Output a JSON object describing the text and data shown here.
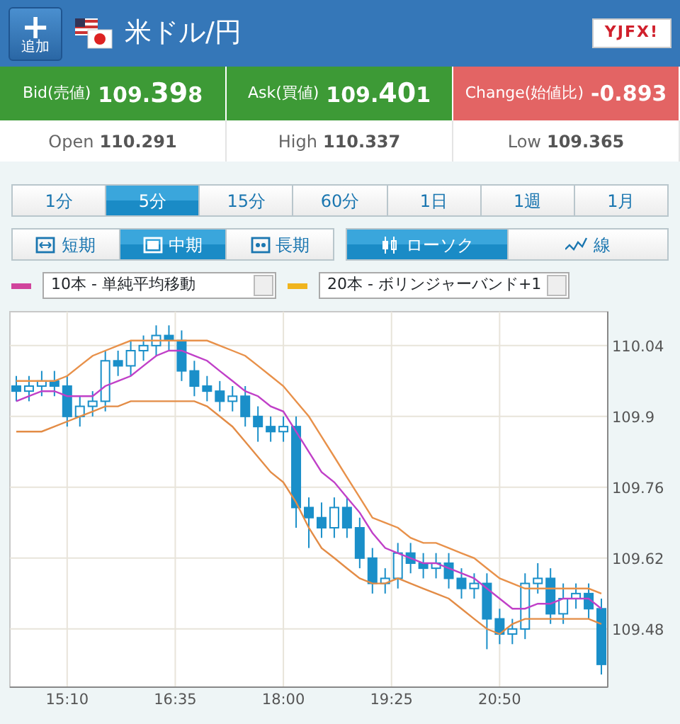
{
  "header": {
    "add_button": {
      "label": "追加",
      "icon": "+"
    },
    "title": "米ドル/円",
    "logo": "YJFX!"
  },
  "quotes": [
    {
      "kind": "up",
      "label": "Bid(売値)",
      "head": "109.",
      "big": "39",
      "tail": "8"
    },
    {
      "kind": "up",
      "label": "Ask(買値)",
      "head": "109.",
      "big": "40",
      "tail": "1"
    },
    {
      "kind": "down",
      "label": "Change(始値比)",
      "head": "-0.893"
    }
  ],
  "stats": [
    {
      "label": "Open",
      "value": "110.291"
    },
    {
      "label": "High",
      "value": "110.337"
    },
    {
      "label": "Low",
      "value": "109.365"
    }
  ],
  "periods": [
    {
      "label": "1分",
      "selected": false
    },
    {
      "label": "5分",
      "selected": true
    },
    {
      "label": "15分",
      "selected": false
    },
    {
      "label": "60分",
      "selected": false
    },
    {
      "label": "1日",
      "selected": false
    },
    {
      "label": "1週",
      "selected": false
    },
    {
      "label": "1月",
      "selected": false
    }
  ],
  "ranges": [
    {
      "kind": "short",
      "label": "短期",
      "selected": false
    },
    {
      "kind": "mid",
      "label": "中期",
      "selected": true
    },
    {
      "kind": "long",
      "label": "長期",
      "selected": false
    }
  ],
  "chart_types": [
    {
      "kind": "candle",
      "label": "ローソク",
      "selected": true
    },
    {
      "kind": "line",
      "label": "線",
      "selected": false
    }
  ],
  "indicators": [
    {
      "color": "#d0449c",
      "value": "10本 - 単純平均移動"
    },
    {
      "color": "#f0b41e",
      "value": "20本 - ボリンジャーバンド+1"
    }
  ],
  "chart_data": {
    "type": "candlestick",
    "grid": true,
    "x": [
      14.5,
      14.6667,
      14.8333,
      15,
      15.1667,
      15.3333,
      15.5,
      15.6667,
      15.8333,
      16,
      16.1667,
      16.3333,
      16.5,
      16.6667,
      16.8333,
      17,
      17.1667,
      17.3333,
      17.5,
      17.6667,
      17.8333,
      18,
      18.1667,
      18.3333,
      18.5,
      18.6667,
      18.8333,
      19,
      19.1667,
      19.3333,
      19.5,
      19.6667,
      19.8333,
      20,
      20.1667,
      20.3333,
      20.5,
      20.6667,
      20.8333,
      21,
      21.1667,
      21.3333,
      21.5,
      21.6667,
      21.8333,
      22,
      22.1667
    ],
    "xlim": [
      14.4167,
      22.25
    ],
    "ylim": [
      109.365,
      110.107
    ],
    "xticks": [
      {
        "value": 15.1667,
        "label": "15:10"
      },
      {
        "value": 16.5833,
        "label": "16:35"
      },
      {
        "value": 18,
        "label": "18:00"
      },
      {
        "value": 19.4167,
        "label": "19:25"
      },
      {
        "value": 20.8333,
        "label": "20:50"
      }
    ],
    "yticks": [
      109.48,
      109.62,
      109.76,
      {
        "value": 109.9,
        "label": "109.9"
      },
      110.04
    ],
    "color": "#1a8fc9",
    "ohlc": [
      [
        109.96,
        109.98,
        109.93,
        109.95
      ],
      [
        109.95,
        109.98,
        109.93,
        109.96
      ],
      [
        109.96,
        109.99,
        109.94,
        109.97
      ],
      [
        109.97,
        109.99,
        109.94,
        109.96
      ],
      [
        109.96,
        109.98,
        109.88,
        109.9
      ],
      [
        109.9,
        109.94,
        109.88,
        109.92
      ],
      [
        109.92,
        109.95,
        109.9,
        109.93
      ],
      [
        109.93,
        110.03,
        109.91,
        110.01
      ],
      [
        110.01,
        110.03,
        109.98,
        110.0
      ],
      [
        110.0,
        110.05,
        109.98,
        110.03
      ],
      [
        110.03,
        110.06,
        110.01,
        110.04
      ],
      [
        110.04,
        110.08,
        110.02,
        110.06
      ],
      [
        110.06,
        110.08,
        110.03,
        110.05
      ],
      [
        110.05,
        110.07,
        109.97,
        109.99
      ],
      [
        109.99,
        110.01,
        109.94,
        109.96
      ],
      [
        109.96,
        109.98,
        109.93,
        109.95
      ],
      [
        109.95,
        109.97,
        109.91,
        109.93
      ],
      [
        109.93,
        109.96,
        109.91,
        109.94
      ],
      [
        109.94,
        109.96,
        109.88,
        109.9
      ],
      [
        109.9,
        109.92,
        109.85,
        109.88
      ],
      [
        109.88,
        109.9,
        109.85,
        109.87
      ],
      [
        109.87,
        109.9,
        109.85,
        109.88
      ],
      [
        109.88,
        109.9,
        109.68,
        109.72
      ],
      [
        109.72,
        109.74,
        109.64,
        109.7
      ],
      [
        109.7,
        109.73,
        109.66,
        109.68
      ],
      [
        109.68,
        109.74,
        109.66,
        109.72
      ],
      [
        109.72,
        109.74,
        109.66,
        109.68
      ],
      [
        109.68,
        109.7,
        109.6,
        109.62
      ],
      [
        109.62,
        109.64,
        109.55,
        109.57
      ],
      [
        109.57,
        109.6,
        109.55,
        109.58
      ],
      [
        109.58,
        109.65,
        109.56,
        109.63
      ],
      [
        109.63,
        109.65,
        109.59,
        109.61
      ],
      [
        109.61,
        109.63,
        109.58,
        109.6
      ],
      [
        109.6,
        109.63,
        109.58,
        109.61
      ],
      [
        109.61,
        109.63,
        109.56,
        109.58
      ],
      [
        109.58,
        109.6,
        109.54,
        109.56
      ],
      [
        109.56,
        109.59,
        109.54,
        109.57
      ],
      [
        109.57,
        109.59,
        109.44,
        109.5
      ],
      [
        109.5,
        109.52,
        109.45,
        109.47
      ],
      [
        109.47,
        109.5,
        109.45,
        109.48
      ],
      [
        109.48,
        109.59,
        109.46,
        109.57
      ],
      [
        109.57,
        109.61,
        109.55,
        109.58
      ],
      [
        109.58,
        109.6,
        109.49,
        109.51
      ],
      [
        109.51,
        109.57,
        109.49,
        109.54
      ],
      [
        109.54,
        109.57,
        109.52,
        109.55
      ],
      [
        109.55,
        109.57,
        109.5,
        109.52
      ],
      [
        109.52,
        109.54,
        109.39,
        109.41
      ]
    ],
    "series": [
      {
        "type": "line",
        "color": "#c040c8",
        "x": [
          14.5,
          14.6667,
          14.8333,
          15,
          15.1667,
          15.3333,
          15.5,
          15.6667,
          15.8333,
          16,
          16.1667,
          16.3333,
          16.5,
          16.6667,
          16.8333,
          17,
          17.1667,
          17.3333,
          17.5,
          17.6667,
          17.8333,
          18,
          18.1667,
          18.3333,
          18.5,
          18.6667,
          18.8333,
          19,
          19.1667,
          19.3333,
          19.5,
          19.6667,
          19.8333,
          20,
          20.1667,
          20.3333,
          20.5,
          20.6667,
          20.8333,
          21,
          21.1667,
          21.3333,
          21.5,
          21.6667,
          21.8333,
          22,
          22.1667
        ],
        "values": [
          109.93,
          109.94,
          109.95,
          109.95,
          109.94,
          109.94,
          109.94,
          109.96,
          109.97,
          109.98,
          110.0,
          110.02,
          110.03,
          110.03,
          110.02,
          110.01,
          109.99,
          109.97,
          109.95,
          109.94,
          109.92,
          109.91,
          109.87,
          109.83,
          109.79,
          109.77,
          109.74,
          109.71,
          109.67,
          109.64,
          109.63,
          109.62,
          109.61,
          109.61,
          109.6,
          109.59,
          109.58,
          109.56,
          109.54,
          109.52,
          109.52,
          109.53,
          109.53,
          109.54,
          109.54,
          109.54,
          109.52
        ]
      },
      {
        "type": "line",
        "color": "#e8914a",
        "x": [
          14.5,
          14.6667,
          14.8333,
          15,
          15.1667,
          15.3333,
          15.5,
          15.6667,
          15.8333,
          16,
          16.1667,
          16.3333,
          16.5,
          16.6667,
          16.8333,
          17,
          17.1667,
          17.3333,
          17.5,
          17.6667,
          17.8333,
          18,
          18.1667,
          18.3333,
          18.5,
          18.6667,
          18.8333,
          19,
          19.1667,
          19.3333,
          19.5,
          19.6667,
          19.8333,
          20,
          20.1667,
          20.3333,
          20.5,
          20.6667,
          20.8333,
          21,
          21.1667,
          21.3333,
          21.5,
          21.6667,
          21.8333,
          22,
          22.1667
        ],
        "values": [
          109.97,
          109.97,
          109.97,
          109.97,
          109.98,
          110.0,
          110.02,
          110.03,
          110.04,
          110.05,
          110.05,
          110.05,
          110.05,
          110.05,
          110.05,
          110.05,
          110.04,
          110.03,
          110.02,
          110.0,
          109.98,
          109.96,
          109.93,
          109.9,
          109.86,
          109.82,
          109.78,
          109.74,
          109.7,
          109.69,
          109.68,
          109.66,
          109.65,
          109.65,
          109.64,
          109.63,
          109.62,
          109.6,
          109.58,
          109.57,
          109.56,
          109.56,
          109.56,
          109.56,
          109.56,
          109.56,
          109.55
        ]
      },
      {
        "type": "line",
        "color": "#e38c46",
        "x": [
          14.5,
          14.6667,
          14.8333,
          15,
          15.1667,
          15.3333,
          15.5,
          15.6667,
          15.8333,
          16,
          16.1667,
          16.3333,
          16.5,
          16.6667,
          16.8333,
          17,
          17.1667,
          17.3333,
          17.5,
          17.6667,
          17.8333,
          18,
          18.1667,
          18.3333,
          18.5,
          18.6667,
          18.8333,
          19,
          19.1667,
          19.3333,
          19.5,
          19.6667,
          19.8333,
          20,
          20.1667,
          20.3333,
          20.5,
          20.6667,
          20.8333,
          21,
          21.1667,
          21.3333,
          21.5,
          21.6667,
          21.8333,
          22,
          22.1667
        ],
        "values": [
          109.87,
          109.87,
          109.87,
          109.88,
          109.89,
          109.9,
          109.91,
          109.92,
          109.92,
          109.93,
          109.93,
          109.93,
          109.93,
          109.93,
          109.93,
          109.92,
          109.9,
          109.88,
          109.85,
          109.82,
          109.79,
          109.77,
          109.73,
          109.68,
          109.64,
          109.62,
          109.6,
          109.58,
          109.57,
          109.57,
          109.58,
          109.57,
          109.56,
          109.55,
          109.54,
          109.52,
          109.5,
          109.48,
          109.47,
          109.49,
          109.5,
          109.5,
          109.5,
          109.5,
          109.5,
          109.5,
          109.49
        ]
      }
    ]
  }
}
